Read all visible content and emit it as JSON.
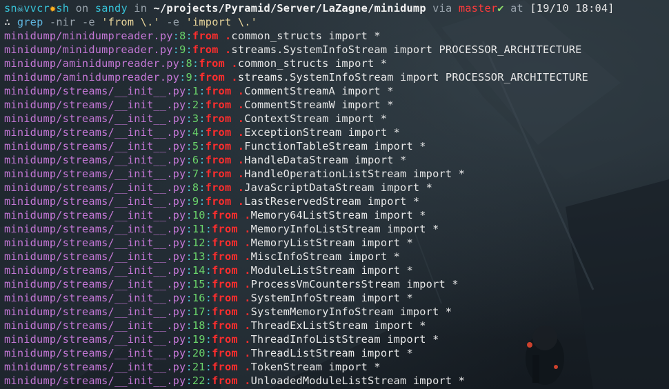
{
  "prompt": {
    "user": "sn",
    "user_icon": "skull-icon",
    "host_prefix": "vvcr",
    "host_icon": "explosion-icon",
    "shell": "sh",
    "on_word": "on",
    "machine": "sandy",
    "in_word": "in",
    "cwd": "~/projects/Pyramid/Server/LaZagne/minidump",
    "via_word": "via",
    "branch": "master",
    "branch_status": "✔",
    "at_word": "at",
    "time": "[19/10 18:04]"
  },
  "command": {
    "symbol": "∴",
    "program": "grep",
    "args": "-nir -e",
    "pattern1": "'from \\.'",
    "flag2": "-e",
    "pattern2": "'import \\.'"
  },
  "results": [
    {
      "file": "minidump/minidumpreader.py",
      "line": "8",
      "match": "from",
      "dot": ".",
      "rest": "common_structs import *"
    },
    {
      "file": "minidump/minidumpreader.py",
      "line": "9",
      "match": "from",
      "dot": ".",
      "rest": "streams.SystemInfoStream import PROCESSOR_ARCHITECTURE"
    },
    {
      "file": "minidump/aminidumpreader.py",
      "line": "8",
      "match": "from",
      "dot": ".",
      "rest": "common_structs import *"
    },
    {
      "file": "minidump/aminidumpreader.py",
      "line": "9",
      "match": "from",
      "dot": ".",
      "rest": "streams.SystemInfoStream import PROCESSOR_ARCHITECTURE"
    },
    {
      "file": "minidump/streams/__init__.py",
      "line": "1",
      "match": "from",
      "dot": ".",
      "rest": "CommentStreamA import *"
    },
    {
      "file": "minidump/streams/__init__.py",
      "line": "2",
      "match": "from",
      "dot": ".",
      "rest": "CommentStreamW import *"
    },
    {
      "file": "minidump/streams/__init__.py",
      "line": "3",
      "match": "from",
      "dot": ".",
      "rest": "ContextStream import *"
    },
    {
      "file": "minidump/streams/__init__.py",
      "line": "4",
      "match": "from",
      "dot": ".",
      "rest": "ExceptionStream import *"
    },
    {
      "file": "minidump/streams/__init__.py",
      "line": "5",
      "match": "from",
      "dot": ".",
      "rest": "FunctionTableStream import *"
    },
    {
      "file": "minidump/streams/__init__.py",
      "line": "6",
      "match": "from",
      "dot": ".",
      "rest": "HandleDataStream import *"
    },
    {
      "file": "minidump/streams/__init__.py",
      "line": "7",
      "match": "from",
      "dot": ".",
      "rest": "HandleOperationListStream import *"
    },
    {
      "file": "minidump/streams/__init__.py",
      "line": "8",
      "match": "from",
      "dot": ".",
      "rest": "JavaScriptDataStream import *"
    },
    {
      "file": "minidump/streams/__init__.py",
      "line": "9",
      "match": "from",
      "dot": ".",
      "rest": "LastReservedStream import *"
    },
    {
      "file": "minidump/streams/__init__.py",
      "line": "10",
      "match": "from",
      "dot": ".",
      "rest": "Memory64ListStream import *"
    },
    {
      "file": "minidump/streams/__init__.py",
      "line": "11",
      "match": "from",
      "dot": ".",
      "rest": "MemoryInfoListStream import *"
    },
    {
      "file": "minidump/streams/__init__.py",
      "line": "12",
      "match": "from",
      "dot": ".",
      "rest": "MemoryListStream import *"
    },
    {
      "file": "minidump/streams/__init__.py",
      "line": "13",
      "match": "from",
      "dot": ".",
      "rest": "MiscInfoStream import *"
    },
    {
      "file": "minidump/streams/__init__.py",
      "line": "14",
      "match": "from",
      "dot": ".",
      "rest": "ModuleListStream import *"
    },
    {
      "file": "minidump/streams/__init__.py",
      "line": "15",
      "match": "from",
      "dot": ".",
      "rest": "ProcessVmCountersStream import *"
    },
    {
      "file": "minidump/streams/__init__.py",
      "line": "16",
      "match": "from",
      "dot": ".",
      "rest": "SystemInfoStream import *"
    },
    {
      "file": "minidump/streams/__init__.py",
      "line": "17",
      "match": "from",
      "dot": ".",
      "rest": "SystemMemoryInfoStream import *"
    },
    {
      "file": "minidump/streams/__init__.py",
      "line": "18",
      "match": "from",
      "dot": ".",
      "rest": "ThreadExListStream import *"
    },
    {
      "file": "minidump/streams/__init__.py",
      "line": "19",
      "match": "from",
      "dot": ".",
      "rest": "ThreadInfoListStream import *"
    },
    {
      "file": "minidump/streams/__init__.py",
      "line": "20",
      "match": "from",
      "dot": ".",
      "rest": "ThreadListStream import *"
    },
    {
      "file": "minidump/streams/__init__.py",
      "line": "21",
      "match": "from",
      "dot": ".",
      "rest": "TokenStream import *"
    },
    {
      "file": "minidump/streams/__init__.py",
      "line": "22",
      "match": "from",
      "dot": ".",
      "rest": "UnloadedModuleListStream import *"
    }
  ],
  "colors": {
    "background": "#1b2229",
    "path": "#c477d6",
    "separator": "#49c3d6",
    "line_number": "#6ad46a",
    "match": "#ff2d2d",
    "text": "#e8e8e8"
  }
}
